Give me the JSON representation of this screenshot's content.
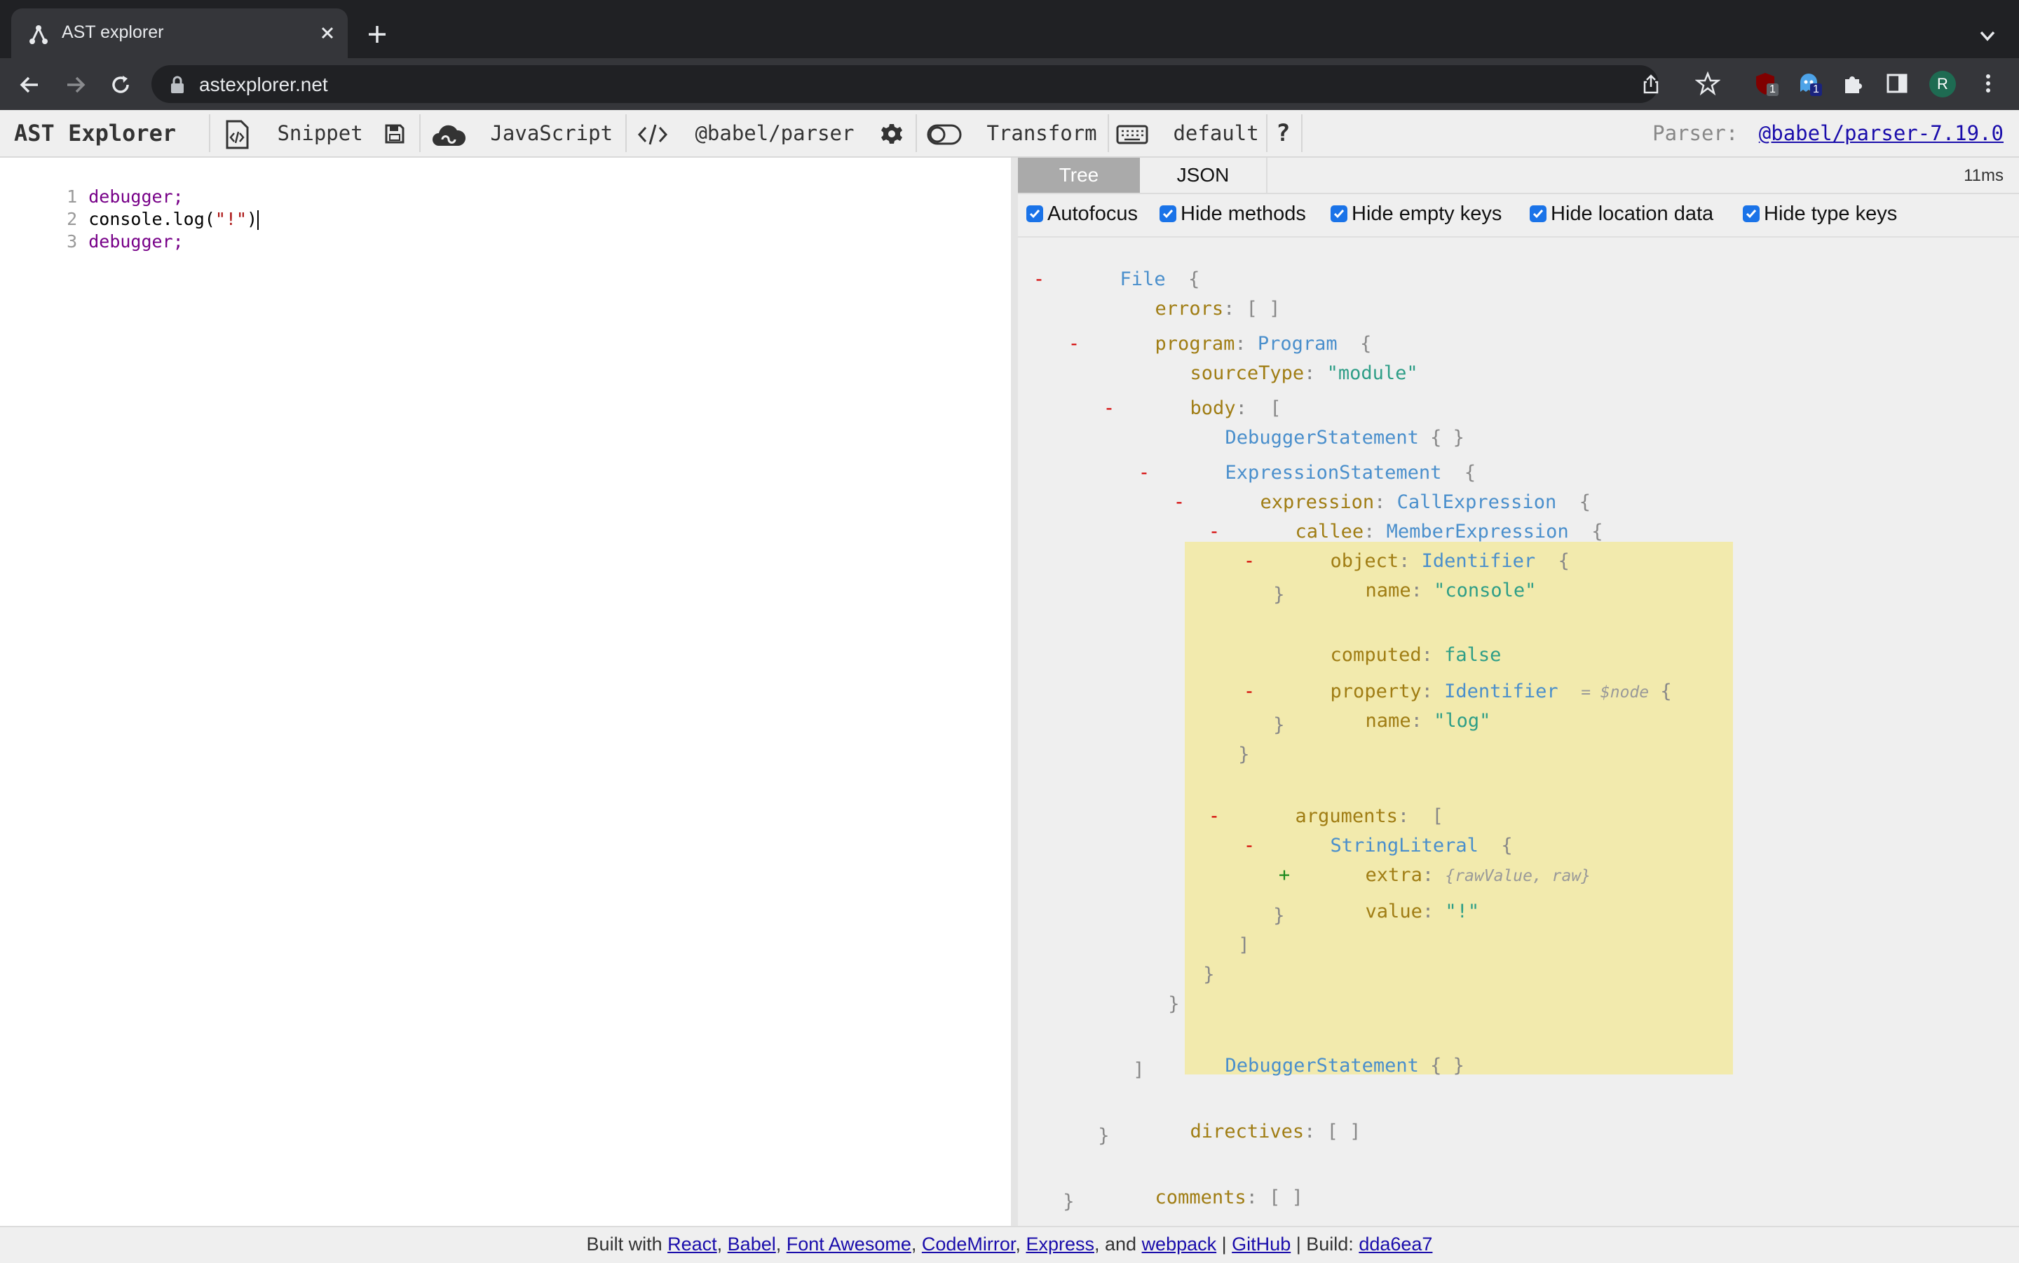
{
  "browser": {
    "tab_title": "AST explorer",
    "url": "astexplorer.net",
    "profile_initial": "R",
    "ext_badge_1": "1",
    "ext_badge_2": "1"
  },
  "toolbar": {
    "brand": "AST Explorer",
    "snippet": "Snippet",
    "language": "JavaScript",
    "parser": "@babel/parser",
    "transform": "Transform",
    "keymap": "default",
    "help": "?",
    "parser_label": "Parser:",
    "parser_version": "@babel/parser-7.19.0"
  },
  "editor": {
    "lines": [
      {
        "num": "1",
        "text": "debugger;"
      },
      {
        "num": "2",
        "prefix": "console.log(",
        "string": "\"!\"",
        "suffix": ")"
      },
      {
        "num": "3",
        "text": "debugger;"
      }
    ]
  },
  "output": {
    "tabs": [
      "Tree",
      "JSON"
    ],
    "timing": "11ms",
    "options": [
      "Autofocus",
      "Hide methods",
      "Hide empty keys",
      "Hide location data",
      "Hide type keys"
    ],
    "tree": {
      "file": "File",
      "errors_key": "errors",
      "program_key": "program",
      "program_type": "Program",
      "sourceType_key": "sourceType",
      "sourceType_val": "\"module\"",
      "body_key": "body",
      "debugger_stmt": "DebuggerStatement",
      "expr_stmt": "ExpressionStatement",
      "expression_key": "expression",
      "call_expr": "CallExpression",
      "callee_key": "callee",
      "member_expr": "MemberExpression",
      "object_key": "object",
      "identifier": "Identifier",
      "name_key": "name",
      "console_val": "\"console\"",
      "computed_key": "computed",
      "computed_val": "false",
      "property_key": "property",
      "node_hint": "= $node",
      "log_val": "\"log\"",
      "arguments_key": "arguments",
      "string_literal": "StringLiteral",
      "extra_key": "extra",
      "extra_summary": "{rawValue, raw}",
      "value_key": "value",
      "value_val": "\"!\"",
      "directives_key": "directives",
      "comments_key": "comments"
    }
  },
  "footer": {
    "built_with": "Built with",
    "links": [
      "React",
      "Babel",
      "Font Awesome",
      "CodeMirror",
      "Express"
    ],
    "and": ", and",
    "webpack": "webpack",
    "github": "GitHub",
    "build_label": "| Build:",
    "build_hash": "dda6ea7"
  }
}
